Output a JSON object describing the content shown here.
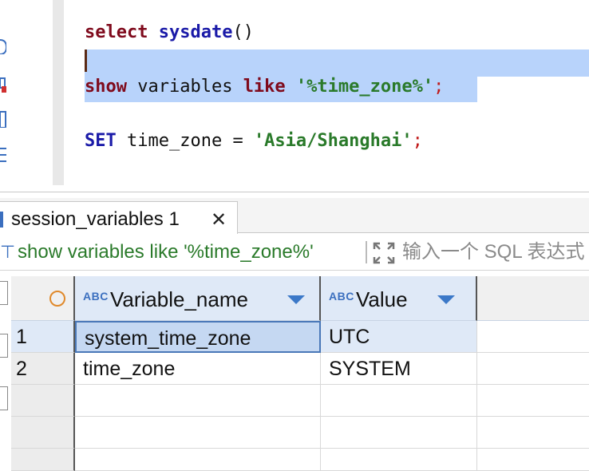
{
  "editor": {
    "line1": {
      "kw": "select",
      "fn": "sysdate",
      "rest": "()"
    },
    "line3": {
      "kw1": "show",
      "mid": " variables ",
      "kw2": "like",
      "sp": " ",
      "str": "'%time_zone%'",
      "semi": ";"
    },
    "line5": {
      "kw": "SET",
      "mid": " time_zone = ",
      "str": "'Asia/Shanghai'",
      "semi": ";"
    }
  },
  "results_tab": {
    "label": "session_variables 1",
    "close": "✕"
  },
  "filter": {
    "query": "show variables like '%time_zone%'",
    "placeholder": "输入一个 SQL 表达式"
  },
  "grid": {
    "columns": [
      {
        "label": "Variable_name",
        "type_badge": "ABC"
      },
      {
        "label": "Value",
        "type_badge": "ABC"
      }
    ],
    "rows": [
      {
        "num": "1",
        "cells": [
          "system_time_zone",
          "UTC"
        ]
      },
      {
        "num": "2",
        "cells": [
          "time_zone",
          "SYSTEM"
        ]
      }
    ]
  },
  "colors": {
    "keyword": "#7f0a1c",
    "function": "#1a1aa8",
    "string": "#2a7a2a",
    "selection": "#b8d3fb",
    "header_bg": "#dfe9f7"
  },
  "icons": [
    "filter-icon",
    "expand-icon",
    "close-icon",
    "sort-arrow-icon",
    "row-indicator-icon"
  ]
}
